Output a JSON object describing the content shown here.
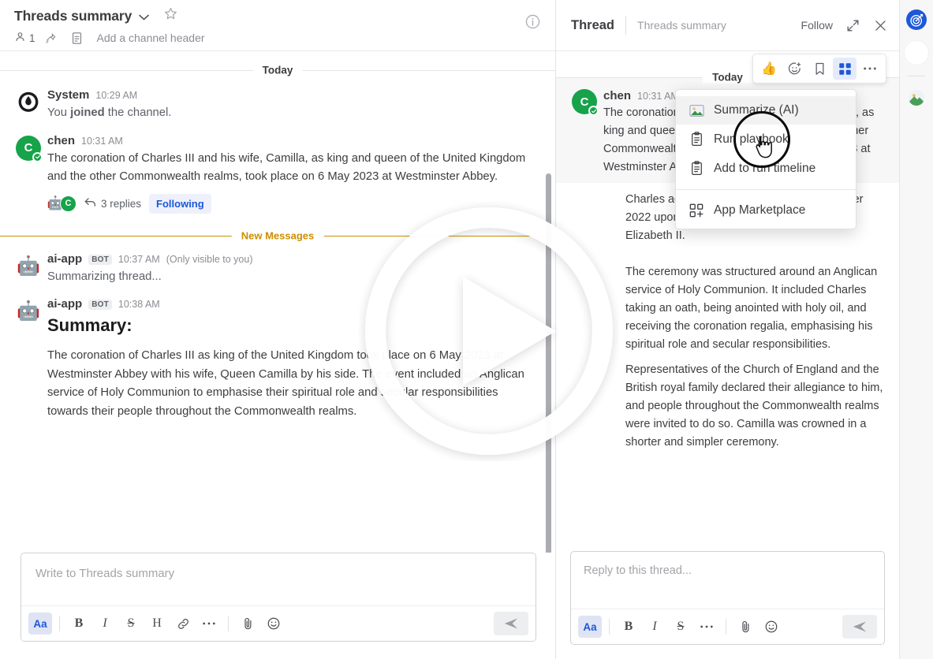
{
  "channel": {
    "title": "Threads summary",
    "member_count": "1",
    "header_placeholder": "Add a channel header",
    "icons": {
      "chevron": "chevron-down-icon",
      "star": "star-icon",
      "members": "members-icon",
      "pin": "pin-icon",
      "doc": "document-icon",
      "info": "info-icon"
    },
    "day_divider": "Today",
    "new_divider": "New Messages",
    "messages": [
      {
        "author": "System",
        "time": "10:29 AM",
        "avatar": "system-logo",
        "text_plain": "You ",
        "text_bold": "joined",
        "text_rest": " the channel."
      },
      {
        "author": "chen",
        "time": "10:31 AM",
        "avatar_initial": "C",
        "text": "The coronation of Charles III and his wife, Camilla, as king and queen of the United Kingdom and the other Commonwealth realms, took place on 6 May 2023 at Westminster Abbey.",
        "replies_label": "3 replies",
        "following_label": "Following"
      },
      {
        "author": "ai-app",
        "bot_tag": "BOT",
        "time": "10:37 AM",
        "visibility": "(Only visible to you)",
        "text": "Summarizing thread..."
      },
      {
        "author": "ai-app",
        "bot_tag": "BOT",
        "time": "10:38 AM",
        "heading": "Summary:",
        "text": "The coronation of Charles III as king of the United Kingdom took place on 6 May 2023 at Westminster Abbey with his wife, Queen Camilla by his side. The event included an Anglican service of Holy Communion to emphasise their spiritual role and secular responsibilities towards their people throughout the Commonwealth realms."
      }
    ],
    "composer": {
      "placeholder": "Write to Threads summary",
      "tools": [
        "Aa",
        "B",
        "I",
        "S",
        "H",
        "link-icon",
        "more-icon",
        "attach-icon",
        "emoji-icon"
      ],
      "send": "send-icon"
    }
  },
  "thread": {
    "title": "Thread",
    "channel_name": "Threads summary",
    "follow_label": "Follow",
    "expand_icon": "expand-icon",
    "close_icon": "close-icon",
    "day_divider": "Today",
    "root": {
      "author": "chen",
      "time": "10:31 AM",
      "avatar_initial": "C",
      "text": "The coronation of Charles III and his wife, Camilla, as king and queen of the United Kingdom and the other Commonwealth realms, took place on 6 May 2023 at Westminster Abbey."
    },
    "replies": [
      {
        "text": "Charles acceded to the throne on 8 September 2022 upon the death of his mother, Queen Elizabeth II."
      },
      {
        "text": "The ceremony was structured around an Anglican service of Holy Communion. It included Charles taking an oath, being anointed with holy oil, and receiving the coronation regalia, emphasising his spiritual role and secular responsibilities."
      },
      {
        "text": "Representatives of the Church of England and the British royal family declared their allegiance to him, and people throughout the Commonwealth realms were invited to do so. Camilla was crowned in a shorter and simpler ceremony."
      }
    ],
    "message_actions": [
      {
        "name": "thumbs-up-reaction",
        "glyph": "👍"
      },
      {
        "name": "add-reaction-icon",
        "glyph": "emoji-plus"
      },
      {
        "name": "save-message-icon",
        "glyph": "bookmark"
      },
      {
        "name": "apps-grid-icon",
        "glyph": "grid",
        "active": true
      },
      {
        "name": "more-actions-icon",
        "glyph": "ellipsis"
      }
    ],
    "dropdown": {
      "items": [
        {
          "label": "Summarize (AI)",
          "icon": "image-icon",
          "highlighted": true
        },
        {
          "label": "Run playbook",
          "icon": "clipboard-icon"
        },
        {
          "label": "Add to run timeline",
          "icon": "clipboard-icon"
        },
        {
          "label": "App Marketplace",
          "icon": "apps-add-icon",
          "separated": true
        }
      ]
    },
    "composer": {
      "placeholder": "Reply to this thread...",
      "tools": [
        "Aa",
        "B",
        "I",
        "S",
        "more-icon",
        "attach-icon",
        "emoji-icon"
      ],
      "send": "send-icon"
    }
  },
  "right_rail": {
    "items": [
      {
        "name": "playbooks-icon",
        "color": "#1c58d9"
      },
      {
        "name": "blank-circle-icon",
        "color": "#ffffff"
      },
      {
        "name": "image-app-icon",
        "color": "#7aa86b"
      }
    ]
  },
  "overlay": {
    "play_button": "play-button-overlay"
  },
  "colors": {
    "accent_blue": "#1c58d9",
    "new_messages": "#cc8f00",
    "green_avatar": "#16a34a",
    "text": "#3d3c40",
    "muted": "#8b8d94"
  }
}
